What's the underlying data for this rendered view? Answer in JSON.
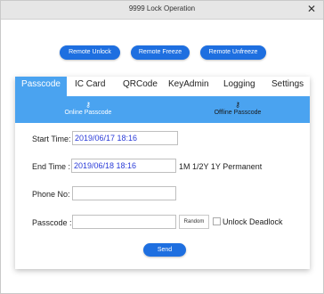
{
  "window": {
    "title": "9999 Lock Operation",
    "close_glyph": "✕"
  },
  "actions": {
    "remote_unlock": "Remote Unlock",
    "remote_freeze": "Remote Freeze",
    "remote_unfreeze": "Remote Unfreeze"
  },
  "tabs": [
    "Passcode",
    "IC Card",
    "QRCode",
    "KeyAdmin",
    "Logging",
    "Settings"
  ],
  "subtabs": {
    "online": {
      "label": "Online Passcode",
      "icon": "key-icon"
    },
    "offline": {
      "label": "Offline Passcode",
      "icon": "key-icon"
    }
  },
  "form": {
    "start_time_label": "Start Time:",
    "start_time_value": "2019/06/17 18:16",
    "end_time_label": "End Time :",
    "end_time_value": "2019/06/18 18:16",
    "quick_ranges": "1M 1/2Y 1Y Permanent",
    "phone_label": "Phone No:",
    "phone_value": "",
    "passcode_label": "Passcode :",
    "passcode_value": "",
    "random_label": "Random",
    "unlock_deadlock_label": "Unlock Deadlock",
    "send_label": "Send"
  },
  "colors": {
    "accent": "#4aa3f0",
    "button": "#1e6fe0"
  }
}
